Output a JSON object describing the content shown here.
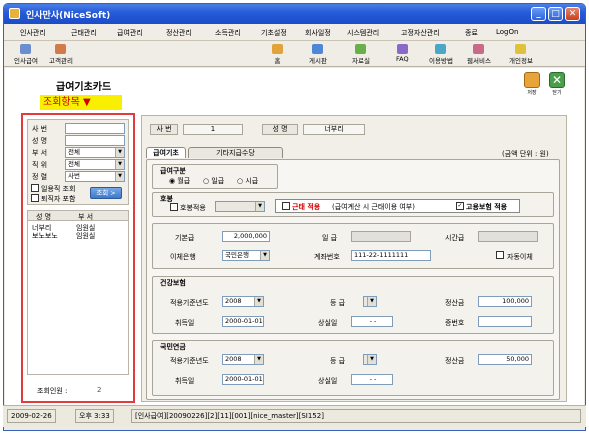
{
  "window": {
    "title": "인사만사(NiceSoft)"
  },
  "menu": [
    "인사관리",
    "근태관리",
    "급여관리",
    "정산관리",
    "소득관리",
    "기초설정",
    "회사일정",
    "시스템관리",
    "고정자산관리",
    "종료",
    "LogOn"
  ],
  "toolbar_left": [
    {
      "label": "인사급여",
      "icon": "person-money-icon"
    },
    {
      "label": "고객관리",
      "icon": "customer-icon"
    }
  ],
  "toolbar_right": [
    {
      "label": "홈",
      "icon": "home-icon"
    },
    {
      "label": "게시판",
      "icon": "board-icon"
    },
    {
      "label": "자료실",
      "icon": "library-icon"
    },
    {
      "label": "FAQ",
      "icon": "faq-icon"
    },
    {
      "label": "이용방법",
      "icon": "guide-icon"
    },
    {
      "label": "웹서비스",
      "icon": "web-icon"
    },
    {
      "label": "개인정보",
      "icon": "privacy-icon"
    }
  ],
  "page": {
    "title": "급여기초카드",
    "subtitle": "조회항목",
    "subtitle_arrow": "▼"
  },
  "side_actions": {
    "save": "저장",
    "close": "닫기"
  },
  "search": {
    "labels": {
      "sabun": "사   번",
      "name": "성   명",
      "dept": "부   서",
      "position": "직   위",
      "sort": "정   렬"
    },
    "dept_value": "전체",
    "position_value": "전체",
    "sort_value": "사번",
    "chk1": "일용직 조회",
    "chk2": "퇴직자 포함",
    "search_button": "조회 >"
  },
  "list": {
    "headers": [
      "성 명",
      "부 서"
    ],
    "rows": [
      [
        "너부리",
        "임원실"
      ],
      [
        "보노보노",
        "임원실"
      ]
    ],
    "count_label": "조회인원 :",
    "count_value": "2"
  },
  "employee": {
    "sabun_label": "사 번",
    "sabun_value": "1",
    "name_label": "성 명",
    "name_value": "너부리"
  },
  "tabs": {
    "active": "급여기초",
    "other": "기타지급수당"
  },
  "unit": "(금액 단위 : 원)",
  "pay_type": {
    "title": "급여구분",
    "options": [
      "월급",
      "일급",
      "시급"
    ],
    "selected": 0
  },
  "hobong": {
    "title": "호봉",
    "check_label": "호봉적용",
    "kunme_label": "근태 적용",
    "kunme_note": "(급여계산 시 근태이용 여부)",
    "employment_ins": "고용보험 적용"
  },
  "salary": {
    "base_label": "기본급",
    "base_value": "2,000,000",
    "daily_label": "일  급",
    "hourly_label": "시간급",
    "bank_label": "이체은행",
    "bank_value": "국민은행",
    "account_label": "계좌번호",
    "account_value": "111-22-1111111",
    "auto_label": "자동이체"
  },
  "health": {
    "title": "건강보험",
    "year_label": "적용기준년도",
    "year_value": "2008",
    "grade_label": "등  급",
    "calc_label": "정산금",
    "calc_value": "100,000",
    "get_label": "취득일",
    "get_value": "2000-01-01",
    "lose_label": "상실일",
    "lose_value": "- -",
    "cert_label": "증번호"
  },
  "pension": {
    "title": "국민연금",
    "year_label": "적용기준년도",
    "year_value": "2008",
    "grade_label": "등  급",
    "calc_label": "정산금",
    "calc_value": "50,000",
    "get_label": "취득일",
    "get_value": "2000-01-01",
    "lose_label": "상실일",
    "lose_value": "- -"
  },
  "status": {
    "date": "2009-02-26",
    "time": "오후 3:33",
    "info": "[인사급여][20090226][2][11][001][nice_master][SI152]"
  }
}
